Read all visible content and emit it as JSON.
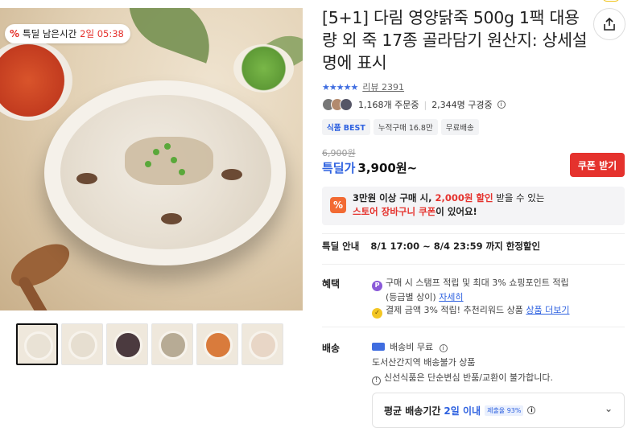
{
  "deal_badge": {
    "label": "특딜 남은시간",
    "time": "2일 05:38"
  },
  "product": {
    "title": "[5+1] 다림 영양닭죽 500g 1팩 대용량 외 죽 17종 골라담기 원산지: 상세설명에 표시",
    "rating_stars": "★★★★★",
    "review_label": "리뷰 2391",
    "orders": "1,168개 주문중",
    "subscribers": "2,344명 구경중"
  },
  "tags": [
    "식품 BEST",
    "누적구매 16.8만",
    "무료배송"
  ],
  "price": {
    "original": "6,900원",
    "label": "특딜가",
    "current": "3,900원~",
    "coupon_button": "쿠폰 받기"
  },
  "promo": {
    "line1_a": "3만원 이상 구매 시, ",
    "line1_b": "2,000원 할인",
    "line1_c": " 받을 수 있는",
    "line2_a": "스토어 장바구니 쿠폰",
    "line2_b": "이 있어요!"
  },
  "deal_info": {
    "label": "특딜 안내",
    "period": "8/1 17:00 ~ 8/4 23:59 까지 한정할인"
  },
  "benefits": {
    "label": "혜택",
    "line1": "구매 시 스탬프 적립 및 최대 3% 쇼핑포인트 적립",
    "line2_a": "(등급별 상이) ",
    "line2_link": "자세히",
    "line3_a": "결제 금액 3% 적립! 추천리워드 상품 ",
    "line3_link": "상품 더보기"
  },
  "shipping": {
    "label": "배송",
    "fee": "배송비 무료",
    "note": "도서산간지역 배송불가 상품",
    "fresh_note": "신선식품은 단순변심 반품/교환이 불가합니다.",
    "delivery_label": "평균 배송기간",
    "delivery_value": "2일 이내",
    "delivery_badge": "제출율 93%"
  },
  "colors": {
    "accent_blue": "#2f62e0",
    "deal_red": "#e5322d",
    "promo_orange": "#f26a33"
  },
  "icons": [
    "share-icon",
    "info-icon",
    "chevron-down-icon",
    "truck-icon",
    "point-icon",
    "reward-icon"
  ]
}
